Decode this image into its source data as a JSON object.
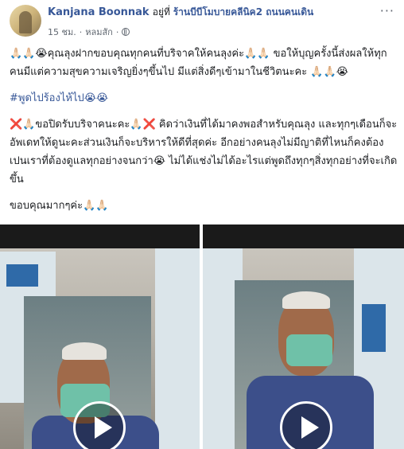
{
  "post": {
    "author": "Kanjana Boonnak",
    "location_prefix": "อยู่ที่",
    "location": "ร้านบีบีโมบายคลีนิค2 ถนนคนเดิน",
    "time": "15 ชม.",
    "separator": "·",
    "place_short": "หลมสัก",
    "separator2": "·",
    "more": "···"
  },
  "body": {
    "p1": "🙏🏻🙏🏻😭คุณลุงฝากขอบคุณทุกคนที่บริจาคให้คนลุงค่ะ🙏🏻🙏🏻 ขอให้บุญครั้งนี้ส่งผลให้ทุกคนมีแต่ความสุขความเจริญยิ่งๆขึ้นไป มีแต่สิ่งดีๆเข้ามาในชีวิตนะคะ 🙏🏻🙏🏻😭",
    "hashtag": "#พูดไปร้องไห้ไป😭😭",
    "p3": "ขอปิดรับบริจาคนะคะ🙏🏻",
    "p3b": "คิดว่าเงินที่ได้มาคงพอสำหรับคุณลุง และทุกๆเดือนก็จะอัพเดทให้ดูนะคะส่วนเงินก็จะบริหารให้ดีที่สุดค่ะ อีกอย่างคนลุงไม่มีญาติที่ไหนก็คงต้องเปนเราที่ต้องดูแลทุกอย่างจนกว่า😭 ไม่ได้แช่งไม่ได้อะไรแต่พูดถึงทุกๆสิ่งทุกอย่างที่จะเกิดขึ้น",
    "cross1": "❌🙏🏻",
    "cross2": "❌",
    "p4": "ขอบคุณมากๆค่ะ🙏🏻🙏🏻"
  },
  "videos": [
    {
      "label": "video-1"
    },
    {
      "label": "video-2"
    }
  ]
}
